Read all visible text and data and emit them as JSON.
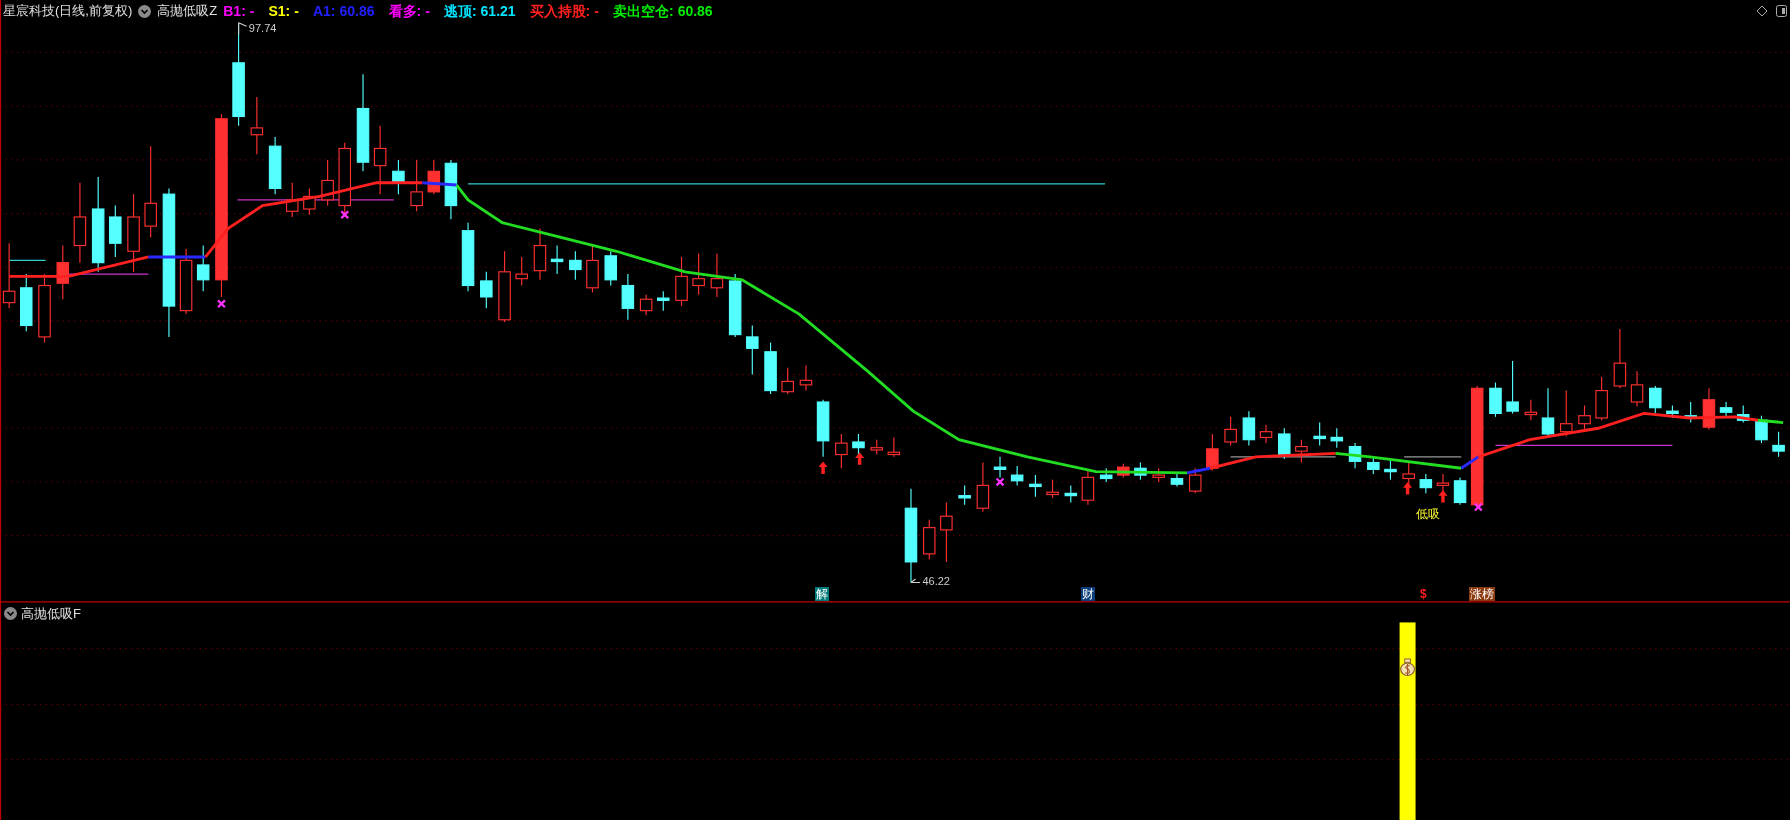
{
  "main_panel": {
    "stock": "星宸科技(日线,前复权)",
    "indicator": "高抛低吸Z",
    "readouts": [
      {
        "label": "B1:",
        "value": "-",
        "color": "#ff00ff"
      },
      {
        "label": "S1:",
        "value": "-",
        "color": "#ffff00"
      },
      {
        "label": "A1:",
        "value": "60.86",
        "color": "#2020ff"
      },
      {
        "label": "看多:",
        "value": "-",
        "color": "#ff00ff"
      },
      {
        "label": "逃顶:",
        "value": "61.21",
        "color": "#00e5ff"
      },
      {
        "label": "买入持股:",
        "value": "-",
        "color": "#ff2020"
      },
      {
        "label": "卖出空仓:",
        "value": "60.86",
        "color": "#00ee00"
      }
    ],
    "high_label": "97.74",
    "low_label": "46.22",
    "signal_label": "低吸",
    "event_tags": [
      {
        "text": "解",
        "color": "#007a7a"
      },
      {
        "text": "财",
        "color": "#0a3d7a"
      },
      {
        "text": "$",
        "color": "#000000"
      },
      {
        "text": "涨榜",
        "color": "#8b3a10"
      }
    ]
  },
  "sub_panel": {
    "indicator": "高抛低吸F"
  }
}
